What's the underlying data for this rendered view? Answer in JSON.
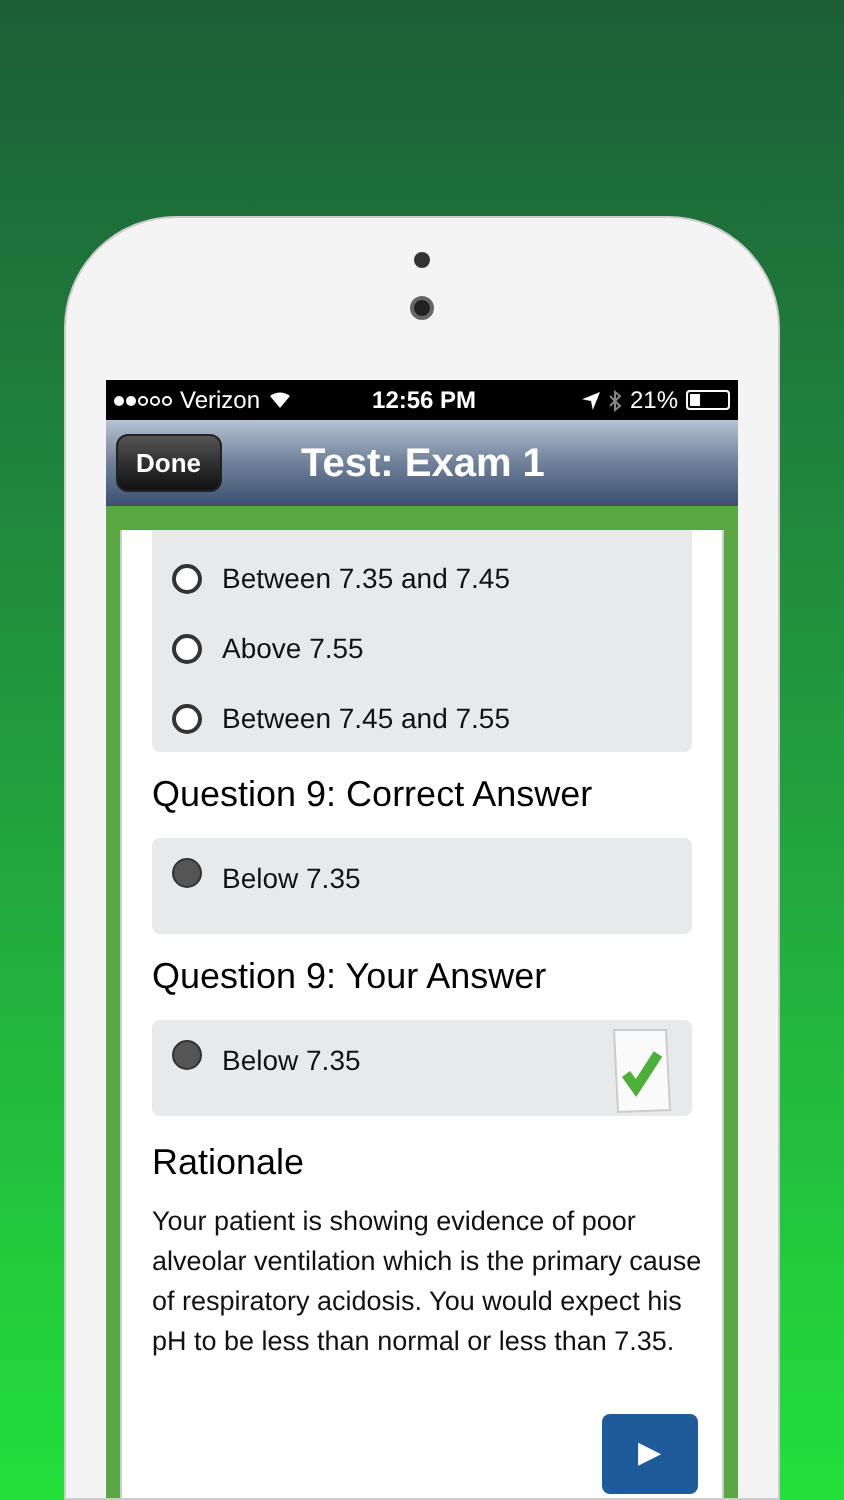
{
  "status_bar": {
    "carrier": "Verizon",
    "time": "12:56 PM",
    "battery": "21%"
  },
  "nav": {
    "done_button": "Done",
    "title": "Test: Exam 1"
  },
  "options": [
    {
      "label": "Between 7.35 and 7.45",
      "selected": false
    },
    {
      "label": "Above 7.55",
      "selected": false
    },
    {
      "label": "Between 7.45 and 7.55",
      "selected": false
    }
  ],
  "sections": [
    {
      "heading": "Question 9: Correct Answer",
      "answer": {
        "label": "Below 7.35",
        "selected": true
      },
      "correct": false
    },
    {
      "heading": "Question 9: Your Answer",
      "answer": {
        "label": "Below 7.35",
        "selected": true
      },
      "correct": true
    }
  ],
  "rationale": {
    "heading": "Rationale",
    "text": "Your patient is showing evidence of poor alveolar ventilation which is the primary cause of respiratory acidosis. You would expect his pH to be less than normal or less than 7.35.",
    "next_button": "▶"
  }
}
